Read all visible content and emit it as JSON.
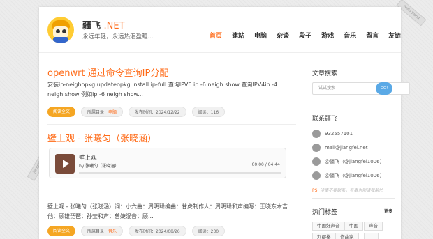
{
  "site": {
    "title": "疆飞",
    "title_suffix": ".NET",
    "slogan": "永远年轻，永远热泪盈眶..."
  },
  "ribbons": {
    "right": "Hello World",
    "left": "jiangfei.net"
  },
  "nav": [
    {
      "label": "首页",
      "active": true
    },
    {
      "label": "建站",
      "active": false
    },
    {
      "label": "电脑",
      "active": false
    },
    {
      "label": "杂谈",
      "active": false
    },
    {
      "label": "段子",
      "active": false
    },
    {
      "label": "游戏",
      "active": false
    },
    {
      "label": "音乐",
      "active": false
    },
    {
      "label": "留言",
      "active": false
    },
    {
      "label": "友链",
      "active": false
    }
  ],
  "posts": [
    {
      "title": "openwrt 通过命令查询IP分配",
      "excerpt": "安装ip-neighopkg updateopkg install ip-full 查询IPV6 ip -6 neigh show 查询IPV4ip -4 neigh show 例如ip -6 neigh show...",
      "read_more": "阅读全文",
      "category_label": "所属目录：",
      "category": "电脑",
      "date": "发布时间：2024/12/22",
      "views": "阅读：116"
    },
    {
      "title": "壁上观 - 张曦匀（张晓涵）",
      "excerpt": "壁上观 - 张曦匀（张晓涵）词：小六曲：周明聪编曲：甘虎制作人：周明聪和声编写：王晓东木吉他：顾雄琵琶：孙莹和声：曾婕混音：顾...",
      "read_more": "阅读全文",
      "category_label": "所属目录：",
      "category": "音乐",
      "date": "发布时间：2024/08/26",
      "views": "阅读：230",
      "player": {
        "title": "壁上观",
        "by": "by",
        "artist": "张曦匀（张晓涵）",
        "time": "00:00 / 04:44"
      }
    }
  ],
  "sidebar": {
    "search_title": "文章搜索",
    "search_placeholder": "试试搜索",
    "search_button": "GO!",
    "contact_title": "联系疆飞",
    "contacts": [
      {
        "icon": "qq-icon",
        "text": "932557101"
      },
      {
        "icon": "mail-icon",
        "text": "mail@jiangfei.net"
      },
      {
        "icon": "weibo-icon",
        "text": "@疆飞（@jiangfei1006）"
      },
      {
        "icon": "twitter-icon",
        "text": "@疆飞（@jiangfei1006）"
      }
    ],
    "notice_prefix": "PS:",
    "notice_text": "没事不要联系，有事也别请我帮忙",
    "tags_title": "热门标签",
    "more": "更多",
    "tags": [
      "中国好声音",
      "中国",
      "声音",
      "刘郡格",
      "作曲家",
      "…"
    ]
  },
  "colors": {
    "accent": "#ff6b18",
    "button": "#f5a623",
    "search_button": "#5aa9e6"
  }
}
